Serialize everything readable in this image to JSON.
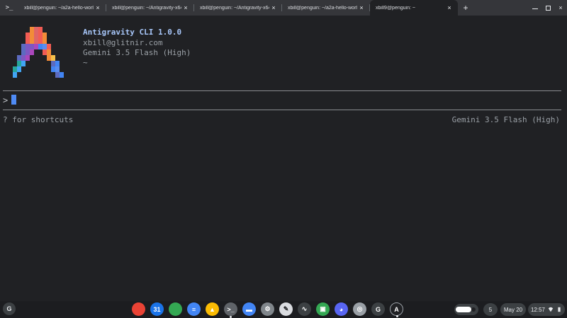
{
  "tabs": [
    {
      "title": "xbill@penguin: ~/a2a-hello-world/p",
      "active": false
    },
    {
      "title": "xbill@penguin: ~/Antigravity-x64",
      "active": false
    },
    {
      "title": "xbill@penguin: ~/Antigravity-x64",
      "active": false
    },
    {
      "title": "xbill@penguin: ~/a2a-hello-world/p",
      "active": false
    },
    {
      "title": "xbill9@penguin: ~",
      "active": true
    }
  ],
  "tabbar": {
    "terminal_glyph": ">_",
    "close_glyph": "×",
    "new_tab": "+"
  },
  "window": {
    "minimize": "",
    "maximize": "",
    "close": "×"
  },
  "terminal": {
    "app_title": "Antigravity CLI 1.0.0",
    "account": "xbill@glitnir.com",
    "model": "Gemini 3.5 Flash (High)",
    "cwd": "~",
    "prompt_symbol": ">",
    "hint": "? for shortcuts",
    "model_status": "Gemini 3.5 Flash (High)"
  },
  "colors": {
    "title": "#a8c7fa",
    "text": "#9aa0a6",
    "cursor": "#4f8bf5",
    "background": "#202124"
  },
  "shelf": {
    "launcher_label": "G",
    "apps": [
      {
        "name": "chrome-icon",
        "label": "",
        "color": "#ea4335",
        "active": false
      },
      {
        "name": "calendar-icon",
        "label": "31",
        "color": "#1a73e8",
        "active": false
      },
      {
        "name": "maps-icon",
        "label": "",
        "color": "#34a853",
        "active": false
      },
      {
        "name": "docs-icon",
        "label": "≡",
        "color": "#4285f4",
        "active": false
      },
      {
        "name": "drive-icon",
        "label": "▲",
        "color": "#fbbc04",
        "active": false
      },
      {
        "name": "terminal-icon",
        "label": ">_",
        "color": "#5f6368",
        "active": true
      },
      {
        "name": "files-icon",
        "label": "▬",
        "color": "#4285f4",
        "active": false
      },
      {
        "name": "settings-icon",
        "label": "⚙",
        "color": "#80868b",
        "active": false
      },
      {
        "name": "text-editor-icon",
        "label": "✎",
        "color": "#dadce0",
        "active": false
      },
      {
        "name": "diagnostics-icon",
        "label": "∿",
        "color": "#3c4043",
        "active": false
      },
      {
        "name": "chat-icon",
        "label": "▣",
        "color": "#34a853",
        "active": false
      },
      {
        "name": "discord-icon",
        "label": "◕",
        "color": "#5865f2",
        "active": false
      },
      {
        "name": "chromium-icon",
        "label": "◎",
        "color": "#9aa0a6",
        "active": false
      },
      {
        "name": "google-app-icon",
        "label": "G",
        "color": "#3c4043",
        "active": false
      },
      {
        "name": "antigravity-icon",
        "label": "A",
        "color": "#202124",
        "active": true
      }
    ],
    "badge_count": "5",
    "date": "May 20",
    "time": "12:57"
  }
}
